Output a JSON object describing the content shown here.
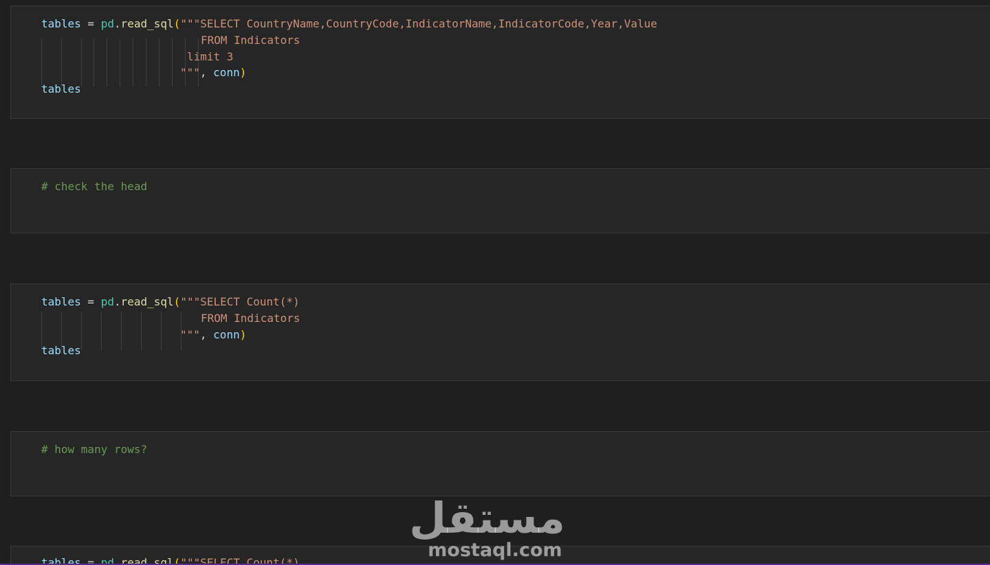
{
  "cells": [
    {
      "type": "code",
      "lines": {
        "l1": {
          "var": "tables",
          "op": " = ",
          "mod": "pd",
          "dot": ".",
          "fn": "read_sql",
          "open": "(",
          "str": "\"\"\"SELECT CountryName,CountryCode,IndicatorName,IndicatorCode,Year,Value"
        },
        "l2": {
          "str": "FROM Indicators"
        },
        "l3": {
          "str": "limit 3"
        },
        "l4": {
          "str": "\"\"\"",
          "sep": ", ",
          "arg": "conn",
          "close": ")"
        },
        "l5": {
          "var": "tables"
        }
      }
    },
    {
      "type": "markdown",
      "comment": "# check the head"
    },
    {
      "type": "code",
      "lines": {
        "l1": {
          "var": "tables",
          "op": " = ",
          "mod": "pd",
          "dot": ".",
          "fn": "read_sql",
          "open": "(",
          "str": "\"\"\"SELECT Count(*)"
        },
        "l2": {
          "str": "FROM Indicators"
        },
        "l3": {
          "str": "\"\"\"",
          "sep": ", ",
          "arg": "conn",
          "close": ")"
        },
        "l4": {
          "var": "tables"
        }
      }
    },
    {
      "type": "markdown",
      "comment": "# how many rows?"
    },
    {
      "type": "code",
      "lines": {
        "l1": {
          "var": "tables",
          "op": " = ",
          "mod": "pd",
          "dot": ".",
          "fn": "read_sql",
          "open": "(",
          "str": "\"\"\"SELECT Count(*)"
        }
      }
    }
  ],
  "watermark": {
    "arabic": "مستقل",
    "latin": "mostaql.com"
  },
  "colors": {
    "background": "#1f1f1f",
    "cell": "#262626",
    "variable": "#9cdcfe",
    "module": "#4ec9b0",
    "function": "#dcdcaa",
    "bracket": "#ffd700",
    "string": "#ce9178",
    "comment": "#6a9955"
  }
}
